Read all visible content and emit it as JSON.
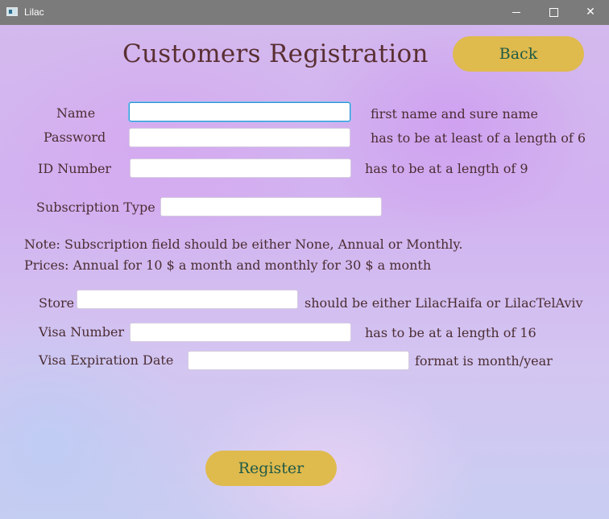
{
  "window": {
    "title": "Lilac",
    "controls": [
      "minimize-icon",
      "maximize-icon",
      "close-icon"
    ]
  },
  "page": {
    "title": "Customers Registration",
    "back_label": "Back",
    "register_label": "Register"
  },
  "form": {
    "name": {
      "label": "Name",
      "value": "",
      "hint": "first name and sure name"
    },
    "password": {
      "label": "Password",
      "value": "",
      "hint": "has to be at least of a length of 6"
    },
    "id_number": {
      "label": "ID Number",
      "value": "",
      "hint": "has to be at a length of 9"
    },
    "subscription_type": {
      "label": "Subscription Type",
      "value": ""
    },
    "note": "Note: Subscription field should be either None, Annual or Monthly.",
    "prices": "Prices: Annual for 10 $ a month and monthly for 30 $ a month",
    "store": {
      "label": "Store",
      "value": "",
      "hint": "should be either LilacHaifa or LilacTelAviv"
    },
    "visa_number": {
      "label": "Visa Number",
      "value": "",
      "hint": "has to be at a length of 16"
    },
    "visa_expiration": {
      "label": "Visa Expiration Date",
      "value": "",
      "hint": "format is month/year"
    }
  },
  "colors": {
    "button_bg": "#dfba4d",
    "button_text": "#1f5a47",
    "title_text": "#5a2f33",
    "focus_border": "#2a8fd6"
  }
}
